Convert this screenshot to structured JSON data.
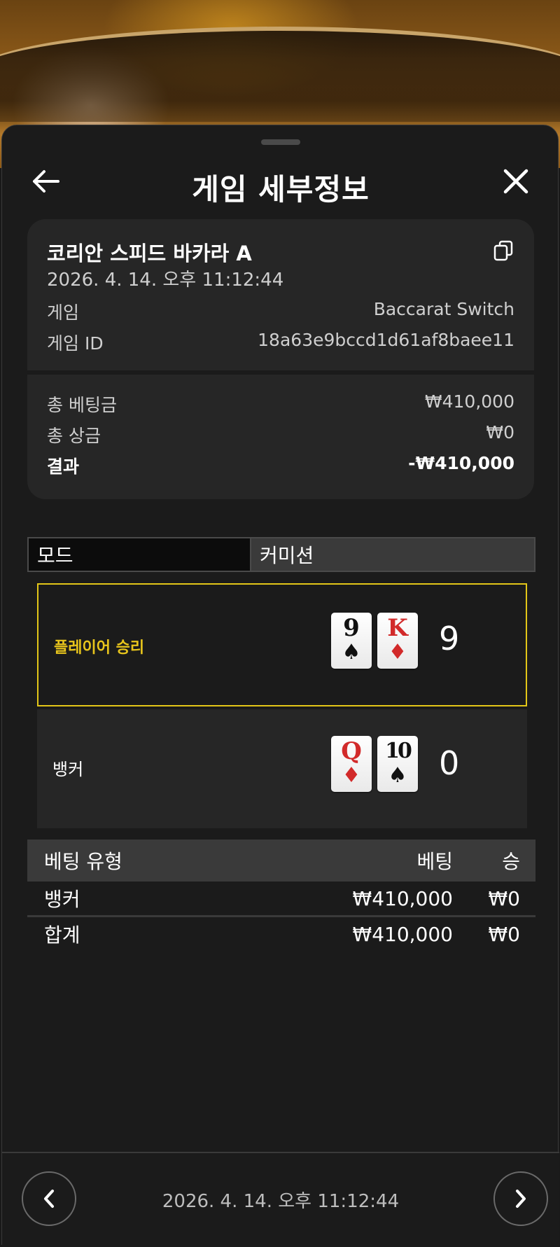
{
  "header": {
    "title": "게임 세부정보"
  },
  "info": {
    "table_name": "코리안 스피드 바카라 A",
    "datetime": "2026. 4. 14. 오후 11:12:44",
    "game_label": "게임",
    "game_value": "Baccarat Switch",
    "game_id_label": "게임 ID",
    "game_id_value": "18a63e9bccd1d61af8baee11",
    "total_bet_label": "총 베팅금",
    "total_bet_value": "₩410,000",
    "total_win_label": "총 상금",
    "total_win_value": "₩0",
    "result_label": "결과",
    "result_value": "-₩410,000"
  },
  "mode_bar": {
    "mode_label": "모드",
    "commission_label": "커미션"
  },
  "outcomes": {
    "player": {
      "label": "플레이어 승리",
      "cards": [
        {
          "rank": "9",
          "suit": "♠"
        },
        {
          "rank": "K",
          "suit": "♦"
        }
      ],
      "score": "9"
    },
    "banker": {
      "label": "뱅커",
      "cards": [
        {
          "rank": "Q",
          "suit": "♦"
        },
        {
          "rank": "10",
          "suit": "♠"
        }
      ],
      "score": "0"
    }
  },
  "bets": {
    "headers": {
      "type": "베팅 유형",
      "bet": "베팅",
      "win": "승"
    },
    "rows": [
      {
        "type": "뱅커",
        "bet": "₩410,000",
        "win": "₩0"
      }
    ],
    "total": {
      "type": "합계",
      "bet": "₩410,000",
      "win": "₩0"
    }
  },
  "footer": {
    "datetime": "2026. 4. 14. 오후 11:12:44"
  },
  "colors": {
    "winner_accent": "#e3c618",
    "red_suit": "#d22a2a",
    "sheet_bg": "#1b1b1b"
  },
  "icons": {
    "back": "arrow-left-icon",
    "close": "close-icon",
    "copy": "copy-icon",
    "prev": "chevron-left-icon",
    "next": "chevron-right-icon"
  }
}
